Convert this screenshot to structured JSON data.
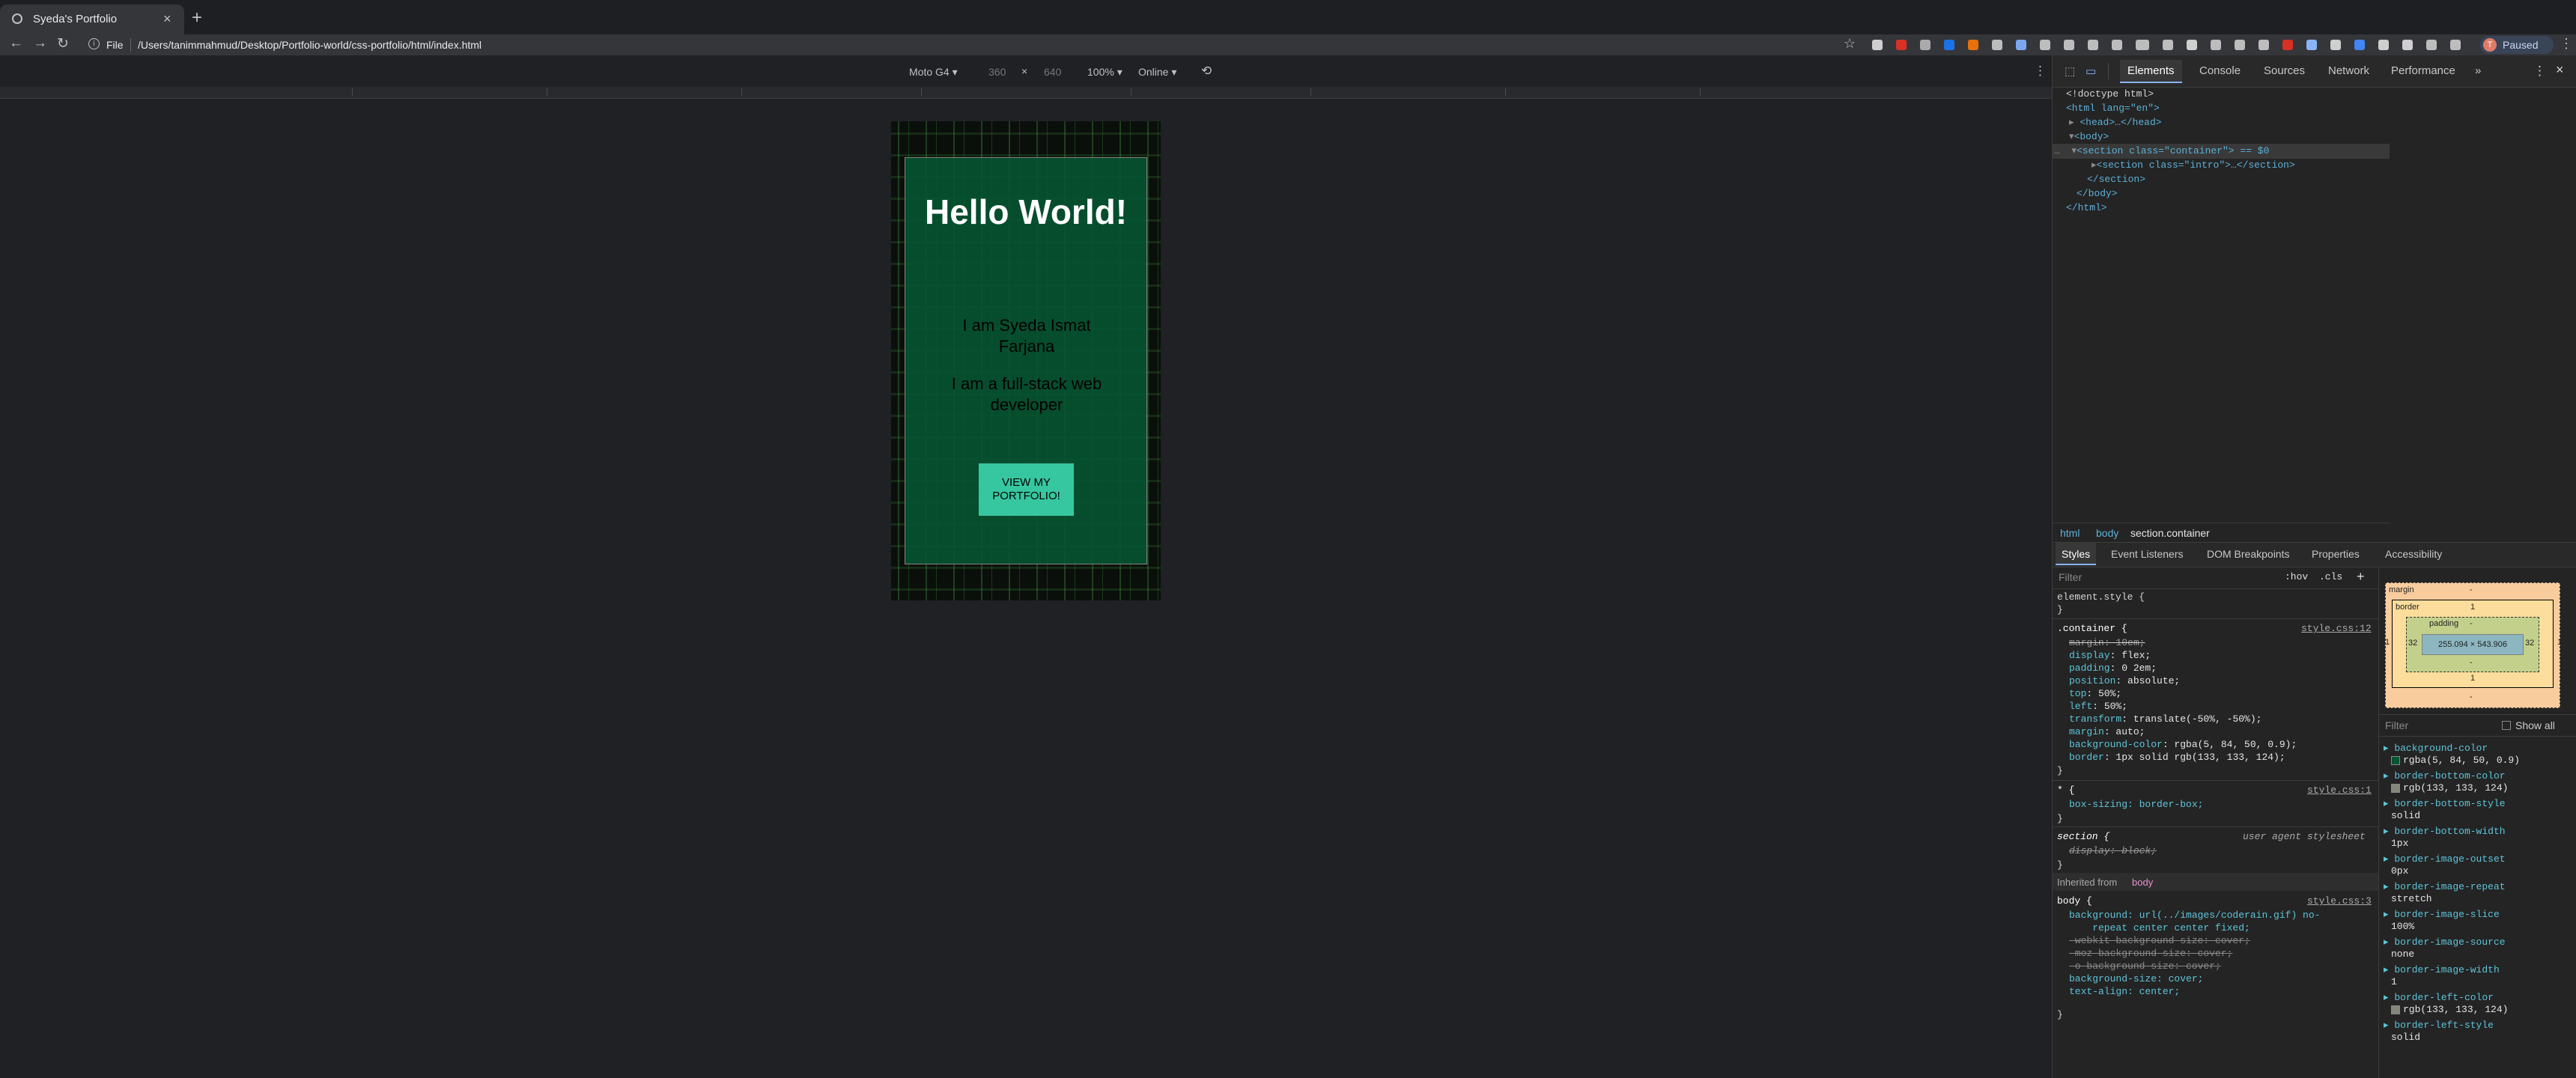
{
  "browser": {
    "tab_title": "Syeda's Portfolio",
    "url_scheme": "File",
    "url": "/Users/tanimmahmud/Desktop/Portfolio-world/css-portfolio/html/index.html",
    "profile_initial": "T",
    "profile_status": "Paused"
  },
  "device_toolbar": {
    "device": "Moto G4",
    "width": "360",
    "times": "×",
    "height": "640",
    "zoom": "100%",
    "network": "Online"
  },
  "page": {
    "heading": "Hello World!",
    "intro_1": "I am Syeda Ismat Farjana",
    "intro_2": "I am a full-stack web developer",
    "cta": "VIEW MY PORTFOLIO!"
  },
  "devtools": {
    "tabs": [
      "Elements",
      "Console",
      "Sources",
      "Network",
      "Performance",
      "»"
    ],
    "dom": {
      "doctype": "<!doctype html>",
      "html_open": "<html lang=\"en\">",
      "head": "<head>…</head>",
      "body_open": "<body>",
      "section_container": "<section class=\"container\"> == $0",
      "section_intro": "<section class=\"intro\">…</section>",
      "section_close": "</section>",
      "body_close": "</body>",
      "html_close": "</html>"
    },
    "breadcrumbs": [
      "html",
      "body",
      "section.container"
    ],
    "subtabs": [
      "Styles",
      "Event Listeners",
      "DOM Breakpoints",
      "Properties",
      "Accessibility"
    ],
    "filter_placeholder": "Filter",
    "hov": ":hov",
    "cls": ".cls",
    "plus": "+",
    "rules": {
      "element_style": "element.style {",
      "close": "}",
      "container_selector": ".container {",
      "container_source": "style.css:12",
      "container_props": [
        {
          "name": "margin",
          "value": "10em;",
          "struck": true
        },
        {
          "name": "display",
          "value": "flex;",
          "struck": false
        },
        {
          "name": "padding",
          "value": "0 2em;",
          "struck": false
        },
        {
          "name": "position",
          "value": "absolute;",
          "struck": false
        },
        {
          "name": "top",
          "value": "50%;",
          "struck": false
        },
        {
          "name": "left",
          "value": "50%;",
          "struck": false
        },
        {
          "name": "transform",
          "value": "translate(-50%, -50%);",
          "struck": false
        },
        {
          "name": "margin",
          "value": "auto;",
          "struck": false
        },
        {
          "name": "background-color",
          "value": "rgba(5, 84, 50, 0.9);",
          "struck": false
        },
        {
          "name": "border",
          "value": "1px solid rgb(133, 133, 124);",
          "struck": false
        }
      ],
      "star_selector": "* {",
      "star_source": "style.css:1",
      "star_prop": "box-sizing: border-box;",
      "section_selector": "section {",
      "section_source": "user agent stylesheet",
      "section_prop": "display: block;",
      "inherited_label": "Inherited from",
      "inherited_from": "body",
      "body_selector": "body {",
      "body_source": "style.css:3",
      "body_props": [
        {
          "text": "background: url(../images/coderain.gif) no-",
          "struck": false
        },
        {
          "text": "    repeat center center fixed;",
          "struck": false
        },
        {
          "text": "-webkit-background-size: cover;",
          "struck": true
        },
        {
          "text": "-moz-background-size: cover;",
          "struck": true
        },
        {
          "text": "-o-background-size: cover;",
          "struck": true
        },
        {
          "text": "background-size: cover;",
          "struck": false
        },
        {
          "text": "text-align: center;",
          "struck": false
        }
      ]
    },
    "box_model": {
      "margin_label": "margin",
      "margin_value": "-",
      "border_label": "border",
      "border_value": "1",
      "padding_label": "padding",
      "padding_value": "-",
      "padding_side": "32",
      "content": "255.094 × 543.906",
      "border_side": "1"
    },
    "computed_filter": "Filter",
    "show_all": "Show all",
    "computed": [
      {
        "name": "background-color",
        "value": "rgba(5, 84, 50, 0.9)",
        "swatch": "#055432"
      },
      {
        "name": "border-bottom-color",
        "value": "rgb(133, 133, 124)",
        "swatch": "#85857c"
      },
      {
        "name": "border-bottom-style",
        "value": "solid"
      },
      {
        "name": "border-bottom-width",
        "value": "1px"
      },
      {
        "name": "border-image-outset",
        "value": "0px"
      },
      {
        "name": "border-image-repeat",
        "value": "stretch"
      },
      {
        "name": "border-image-slice",
        "value": "100%"
      },
      {
        "name": "border-image-source",
        "value": "none"
      },
      {
        "name": "border-image-width",
        "value": "1"
      },
      {
        "name": "border-left-color",
        "value": "rgb(133, 133, 124)",
        "swatch": "#85857c"
      },
      {
        "name": "border-left-style",
        "value": "solid"
      }
    ]
  }
}
